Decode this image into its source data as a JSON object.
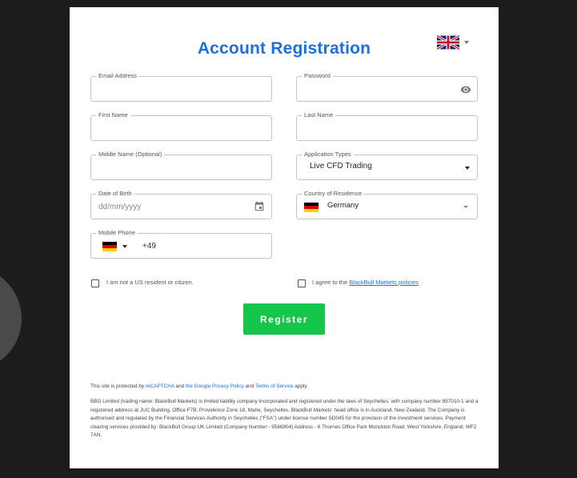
{
  "form": {
    "title": "Account Registration",
    "email": {
      "label": "Email Address",
      "value": ""
    },
    "password": {
      "label": "Password",
      "value": ""
    },
    "first_name": {
      "label": "First Name",
      "value": ""
    },
    "last_name": {
      "label": "Last Name",
      "value": ""
    },
    "middle_name": {
      "label": "Middle Name (Optional)",
      "value": ""
    },
    "application_type": {
      "label": "Application Types",
      "value": "Live CFD Trading"
    },
    "dob": {
      "label": "Date of Birth",
      "placeholder": "dd/mm/yyyy"
    },
    "country": {
      "label": "Country of Residence",
      "value": "Germany"
    },
    "phone": {
      "label": "Mobile Phone",
      "value": "+49"
    },
    "us_checkbox_label": "I am not a US resident or citizen.",
    "agree_prefix": "I agree to the ",
    "agree_link": "BlackBull Markets policies",
    "register_label": "Register"
  },
  "footer": {
    "recaptcha_1": "This site is protected by ",
    "recaptcha_link_1": "reCAPTCHA",
    "recaptcha_2": " and ",
    "recaptcha_link_2": "the Google Privacy Policy",
    "recaptcha_3": " and ",
    "recaptcha_link_3": "Terms of Service",
    "recaptcha_4": " apply.",
    "legal": "BBG Limited (trading name: BlackBull Markets) is limited liability company incorporated and registered under the laws of Seychelles, with company number 857010-1 and a registered address at JUC Building, Office F7B, Providence Zone 18, Mahe, Seychelles. BlackBull Markets' head office is in Auckland, New Zealand. The Company is authorised and regulated by the Financial Services Authority in Seychelles (\"FSA\") under license number SD045 for the provision of the investment services. Payment clearing services provided by: BlackBull Group UK Limited (Company Number - 9586804) Address - 6 Thornes Office Park Monckton Road, West Yorkshire, England, WF2 7AN."
  },
  "icons": {
    "language": "uk-flag-icon",
    "password_toggle": "eye-icon",
    "calendar": "calendar-icon",
    "country_flag": "germany-flag-icon"
  },
  "colors": {
    "accent": "#1d6fe0",
    "button": "#16c64b",
    "background": "#1c1c1c"
  }
}
